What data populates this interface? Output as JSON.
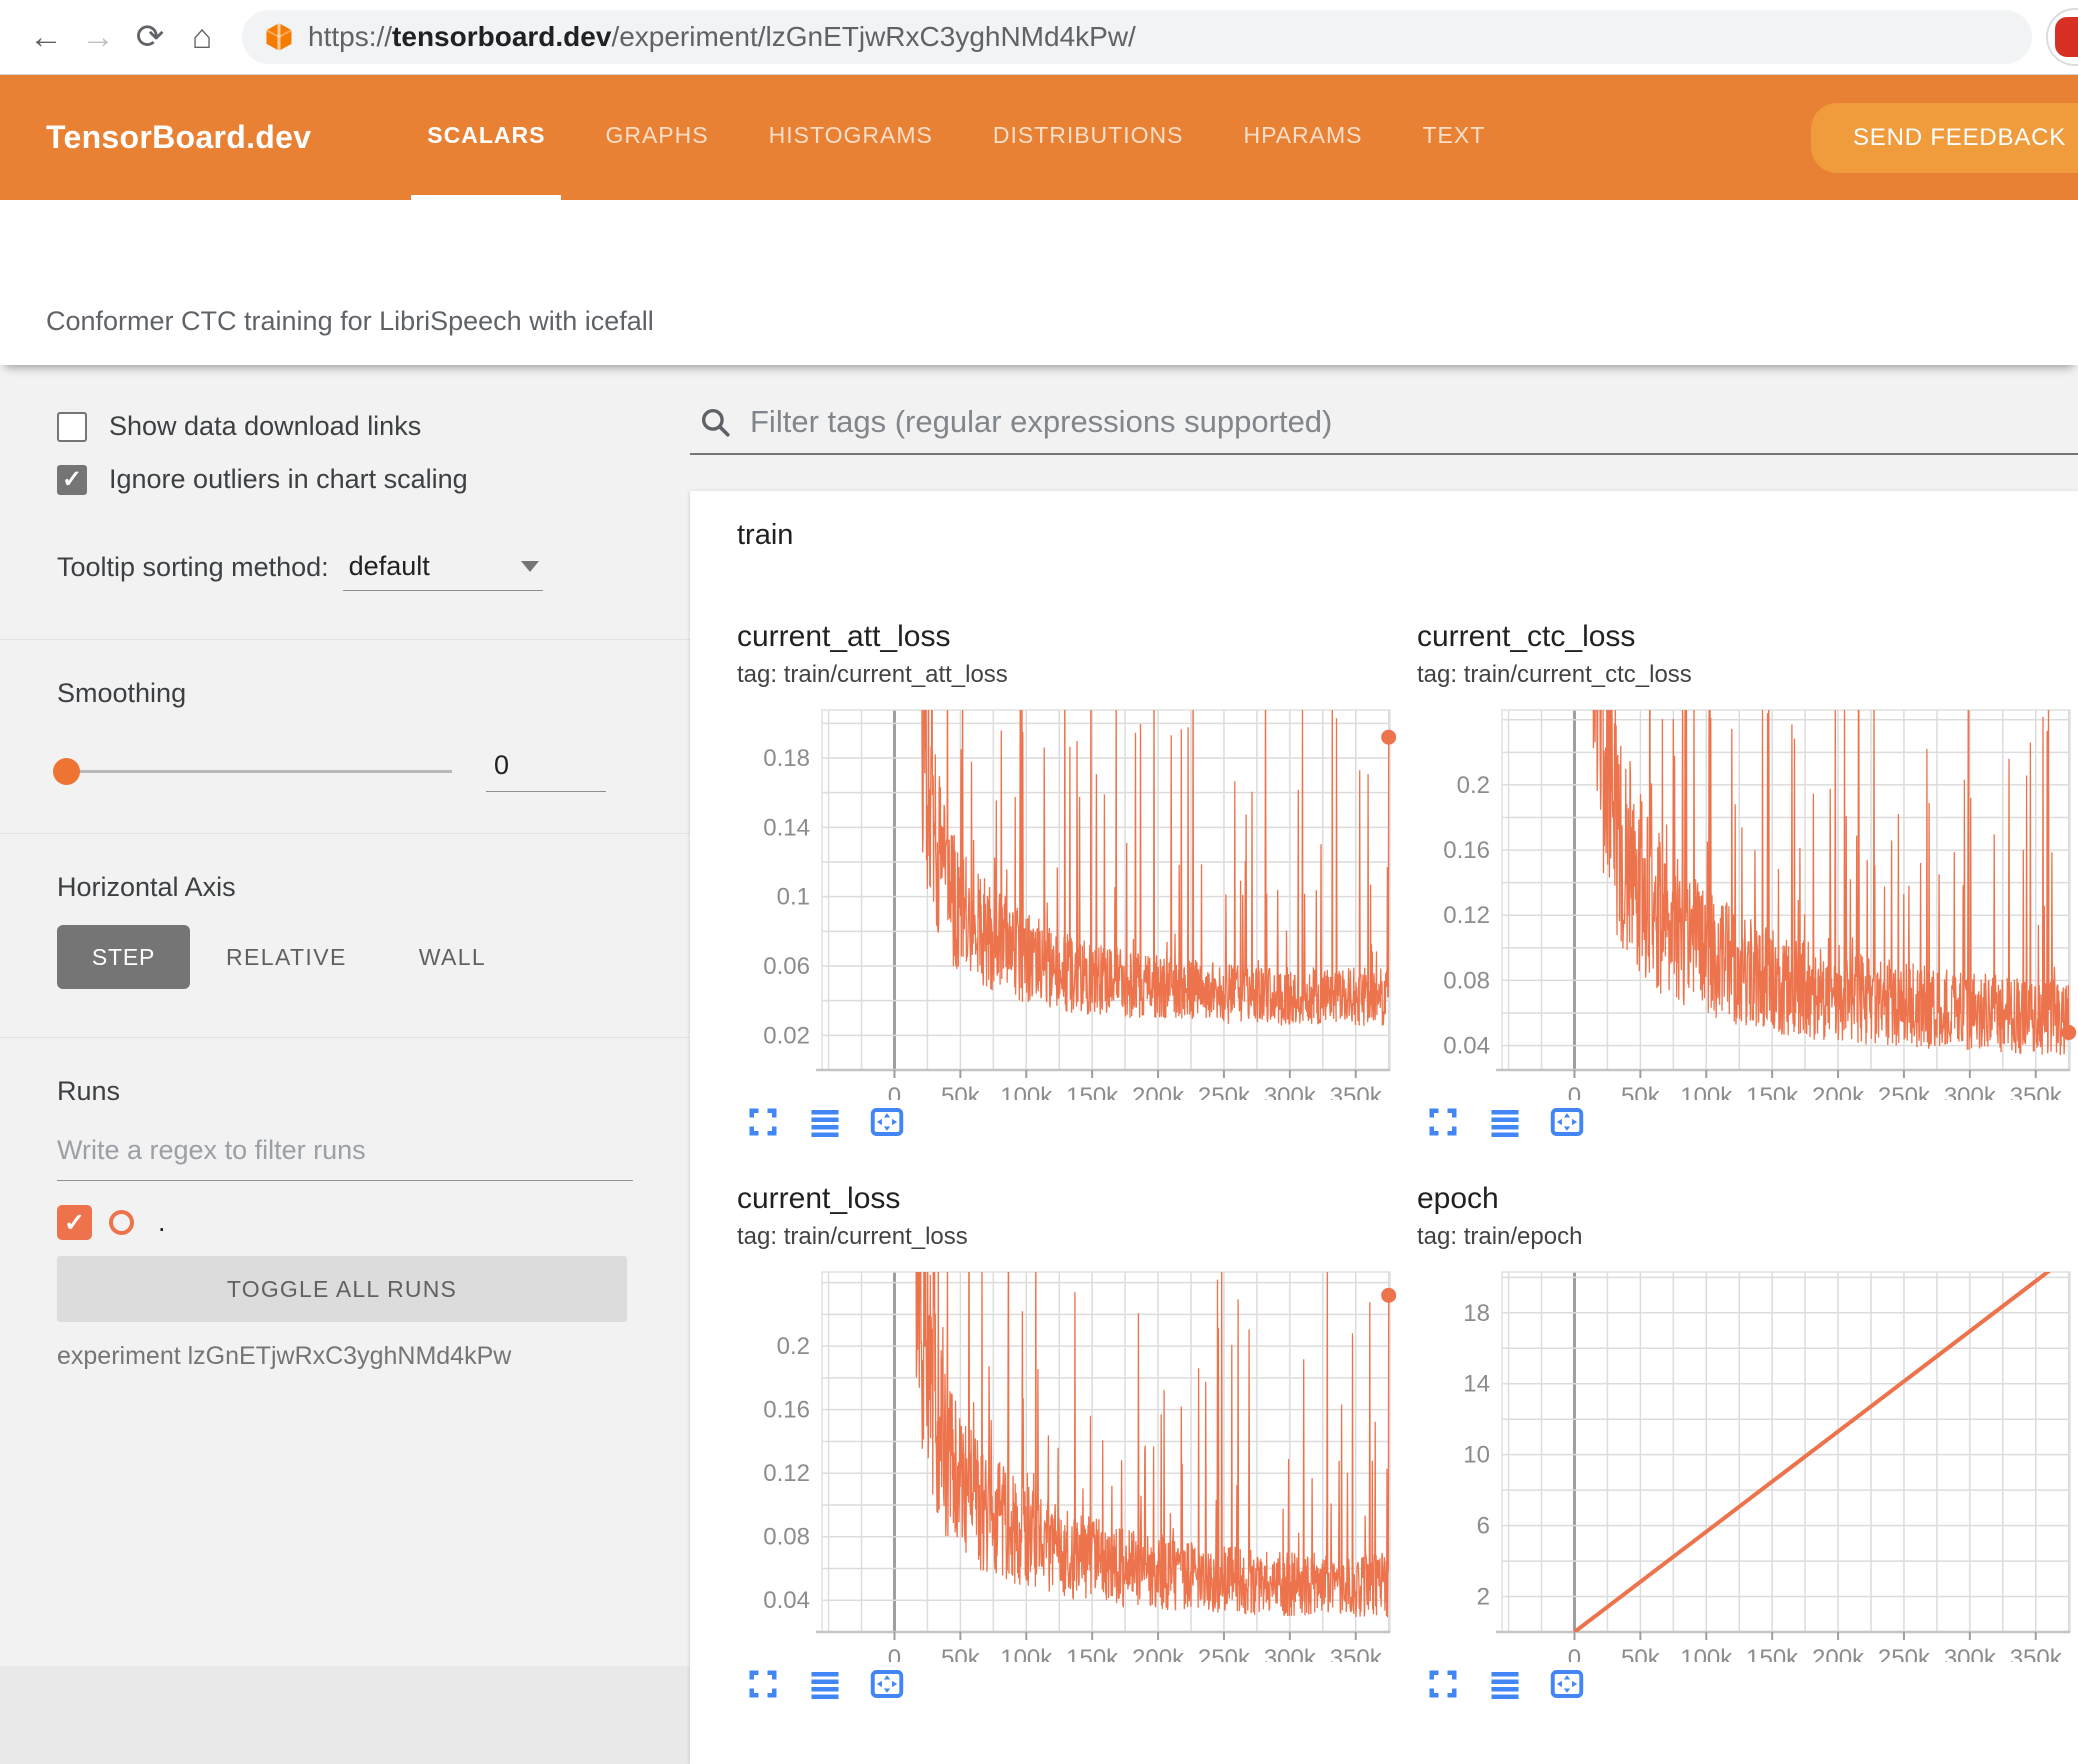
{
  "colors": {
    "header_orange": "#e98135",
    "feedback_orange": "#f09c3c",
    "series_orange": "#ed734c",
    "icon_blue": "#4285f4",
    "checkbox_orange": "#ee734d",
    "grid_light": "#dcdcdc",
    "grid_zero": "#9e9e9e",
    "axis_label": "#8c8c8c"
  },
  "browser": {
    "url_prefix": "https://",
    "url_domain": "tensorboard.dev",
    "url_path": "/experiment/lzGnETjwRxC3yghNMd4kPw/"
  },
  "header": {
    "logo": "TensorBoard.dev",
    "tabs": [
      {
        "label": "SCALARS",
        "active": true
      },
      {
        "label": "GRAPHS",
        "active": false
      },
      {
        "label": "HISTOGRAMS",
        "active": false
      },
      {
        "label": "DISTRIBUTIONS",
        "active": false
      },
      {
        "label": "HPARAMS",
        "active": false
      },
      {
        "label": "TEXT",
        "active": false
      }
    ],
    "feedback_label": "SEND FEEDBACK"
  },
  "title_band": {
    "experiment_title": "Conformer CTC training for LibriSpeech with icefall"
  },
  "sidebar": {
    "checkbox_download": {
      "label": "Show data download links",
      "checked": false
    },
    "checkbox_outliers": {
      "label": "Ignore outliers in chart scaling",
      "checked": true
    },
    "tooltip_label": "Tooltip sorting method:",
    "tooltip_value": "default",
    "smoothing_label": "Smoothing",
    "smoothing_value": "0",
    "haxis_label": "Horizontal Axis",
    "haxis_options": {
      "step": "STEP",
      "relative": "RELATIVE",
      "wall": "WALL",
      "selected": "STEP"
    },
    "runs_label": "Runs",
    "runs_filter_placeholder": "Write a regex to filter runs",
    "run_name": ".",
    "toggle_all_label": "TOGGLE ALL RUNS",
    "experiment_caption": "experiment lzGnETjwRxC3yghNMd4kPw"
  },
  "main": {
    "filter_placeholder": "Filter tags (regular expressions supported)",
    "card_title": "train"
  },
  "chart_data": [
    {
      "type": "line",
      "title": "current_att_loss",
      "tag": "tag: train/current_att_loss",
      "x_range": [
        -55000,
        376000
      ],
      "x_grid_step": 25000,
      "x_ticks": [
        {
          "v": 0,
          "t": "0"
        },
        {
          "v": 50000,
          "t": "50k"
        },
        {
          "v": 100000,
          "t": "100k"
        },
        {
          "v": 150000,
          "t": "150k"
        },
        {
          "v": 200000,
          "t": "200k"
        },
        {
          "v": 250000,
          "t": "250k"
        },
        {
          "v": 300000,
          "t": "300k"
        },
        {
          "v": 350000,
          "t": "350k"
        }
      ],
      "y_range": [
        0,
        0.2077
      ],
      "y_grid": [
        0.02,
        0.04,
        0.06,
        0.08,
        0.1,
        0.12,
        0.14,
        0.16,
        0.18,
        0.2
      ],
      "y_labels": [
        {
          "v": 0.18,
          "t": "0.18"
        },
        {
          "v": 0.14,
          "t": "0.14"
        },
        {
          "v": 0.1,
          "t": "0.1"
        },
        {
          "v": 0.06,
          "t": "0.06"
        },
        {
          "v": 0.02,
          "t": "0.02"
        }
      ],
      "trend": [
        [
          8000,
          0.55
        ],
        [
          14000,
          0.3
        ],
        [
          22000,
          0.17
        ],
        [
          32000,
          0.12
        ],
        [
          45000,
          0.095
        ],
        [
          65000,
          0.078
        ],
        [
          95000,
          0.063
        ],
        [
          135000,
          0.053
        ],
        [
          180000,
          0.047
        ],
        [
          240000,
          0.043
        ],
        [
          300000,
          0.041
        ],
        [
          375000,
          0.04
        ]
      ],
      "noise": {
        "seed": 11,
        "n": 1150,
        "x_start": 8000,
        "x_end": 375000,
        "jitter_min": 0.62,
        "jitter_span": 0.85,
        "spike_p": 0.1,
        "spike_max": 0.2,
        "floor": 0.012
      },
      "end_dot": {
        "x": 375000,
        "y": 0.192
      },
      "stroke_width": 1.3
    },
    {
      "type": "line",
      "title": "current_ctc_loss",
      "tag": "tag: train/current_ctc_loss",
      "x_range": [
        -55000,
        376000
      ],
      "x_grid_step": 25000,
      "x_ticks": [
        {
          "v": 0,
          "t": "0"
        },
        {
          "v": 50000,
          "t": "50k"
        },
        {
          "v": 100000,
          "t": "100k"
        },
        {
          "v": 150000,
          "t": "150k"
        },
        {
          "v": 200000,
          "t": "200k"
        },
        {
          "v": 250000,
          "t": "250k"
        },
        {
          "v": 300000,
          "t": "300k"
        },
        {
          "v": 350000,
          "t": "350k"
        }
      ],
      "y_range": [
        0.025,
        0.246
      ],
      "y_grid": [
        0.04,
        0.06,
        0.08,
        0.1,
        0.12,
        0.14,
        0.16,
        0.18,
        0.2,
        0.22,
        0.24
      ],
      "y_labels": [
        {
          "v": 0.2,
          "t": "0.2"
        },
        {
          "v": 0.16,
          "t": "0.16"
        },
        {
          "v": 0.12,
          "t": "0.12"
        },
        {
          "v": 0.08,
          "t": "0.08"
        },
        {
          "v": 0.04,
          "t": "0.04"
        }
      ],
      "trend": [
        [
          8000,
          0.62
        ],
        [
          14000,
          0.36
        ],
        [
          22000,
          0.23
        ],
        [
          32000,
          0.17
        ],
        [
          45000,
          0.14
        ],
        [
          65000,
          0.115
        ],
        [
          95000,
          0.095
        ],
        [
          135000,
          0.08
        ],
        [
          180000,
          0.07
        ],
        [
          240000,
          0.063
        ],
        [
          300000,
          0.058
        ],
        [
          375000,
          0.054
        ]
      ],
      "noise": {
        "seed": 23,
        "n": 1150,
        "x_start": 8000,
        "x_end": 375000,
        "jitter_min": 0.62,
        "jitter_span": 0.85,
        "spike_p": 0.085,
        "spike_max": 0.22,
        "floor": 0.028
      },
      "end_dot": {
        "x": 375000,
        "y": 0.048
      },
      "stroke_width": 1.3
    },
    {
      "type": "line",
      "title": "current_loss",
      "tag": "tag: train/current_loss",
      "x_range": [
        -55000,
        376000
      ],
      "x_grid_step": 25000,
      "x_ticks": [
        {
          "v": 0,
          "t": "0"
        },
        {
          "v": 50000,
          "t": "50k"
        },
        {
          "v": 100000,
          "t": "100k"
        },
        {
          "v": 150000,
          "t": "150k"
        },
        {
          "v": 200000,
          "t": "200k"
        },
        {
          "v": 250000,
          "t": "250k"
        },
        {
          "v": 300000,
          "t": "300k"
        },
        {
          "v": 350000,
          "t": "350k"
        }
      ],
      "y_range": [
        0.02,
        0.2467
      ],
      "y_grid": [
        0.04,
        0.06,
        0.08,
        0.1,
        0.12,
        0.14,
        0.16,
        0.18,
        0.2,
        0.22,
        0.24
      ],
      "y_labels": [
        {
          "v": 0.2,
          "t": "0.2"
        },
        {
          "v": 0.16,
          "t": "0.16"
        },
        {
          "v": 0.12,
          "t": "0.12"
        },
        {
          "v": 0.08,
          "t": "0.08"
        },
        {
          "v": 0.04,
          "t": "0.04"
        }
      ],
      "trend": [
        [
          8000,
          0.58
        ],
        [
          14000,
          0.33
        ],
        [
          22000,
          0.2
        ],
        [
          32000,
          0.145
        ],
        [
          45000,
          0.115
        ],
        [
          65000,
          0.095
        ],
        [
          95000,
          0.078
        ],
        [
          135000,
          0.065
        ],
        [
          180000,
          0.057
        ],
        [
          240000,
          0.051
        ],
        [
          300000,
          0.048
        ],
        [
          375000,
          0.047
        ]
      ],
      "noise": {
        "seed": 37,
        "n": 1150,
        "x_start": 8000,
        "x_end": 375000,
        "jitter_min": 0.62,
        "jitter_span": 0.85,
        "spike_p": 0.095,
        "spike_max": 0.21,
        "floor": 0.024
      },
      "end_dot": {
        "x": 375000,
        "y": 0.232
      },
      "stroke_width": 1.3
    },
    {
      "type": "line",
      "title": "epoch",
      "tag": "tag: train/epoch",
      "x_range": [
        -55000,
        376000
      ],
      "x_grid_step": 25000,
      "x_ticks": [
        {
          "v": 0,
          "t": "0"
        },
        {
          "v": 50000,
          "t": "50k"
        },
        {
          "v": 100000,
          "t": "100k"
        },
        {
          "v": 150000,
          "t": "150k"
        },
        {
          "v": 200000,
          "t": "200k"
        },
        {
          "v": 250000,
          "t": "250k"
        },
        {
          "v": 300000,
          "t": "300k"
        },
        {
          "v": 350000,
          "t": "350k"
        }
      ],
      "y_range": [
        0,
        20.3
      ],
      "y_grid": [
        2,
        4,
        6,
        8,
        10,
        12,
        14,
        16,
        18,
        20
      ],
      "y_labels": [
        {
          "v": 18,
          "t": "18"
        },
        {
          "v": 14,
          "t": "14"
        },
        {
          "v": 10,
          "t": "10"
        },
        {
          "v": 6,
          "t": "6"
        },
        {
          "v": 2,
          "t": "2"
        }
      ],
      "line": [
        [
          0,
          0
        ],
        [
          375000,
          21.2
        ]
      ],
      "stroke_width": 4
    }
  ]
}
